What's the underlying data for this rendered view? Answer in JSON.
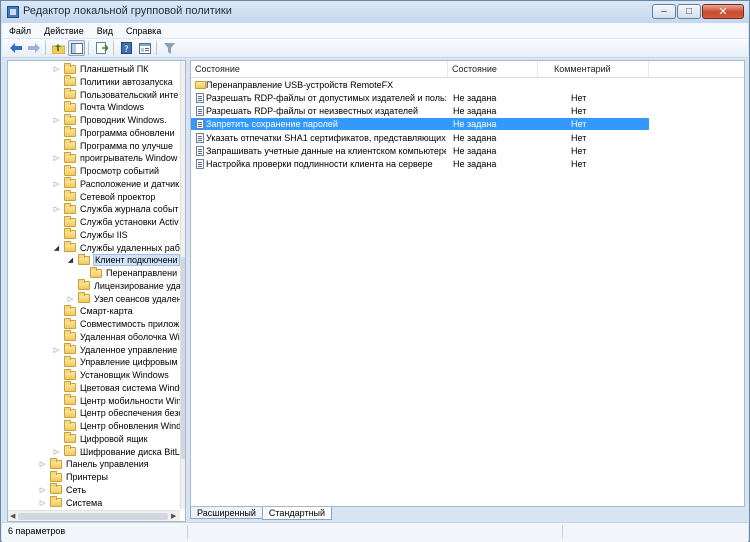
{
  "window": {
    "title": "Редактор локальной групповой политики"
  },
  "menu": [
    "Файл",
    "Действие",
    "Вид",
    "Справка"
  ],
  "toolbar": {
    "icons": [
      "back-arrow",
      "forward-arrow",
      "up-folder",
      "show-hide-tree",
      "export-list",
      "help",
      "properties",
      "filter"
    ],
    "colors": {
      "accent": "#3399ff",
      "nav_arrow": "#2f6fc6"
    }
  },
  "tree": {
    "items": [
      {
        "label": "Планшетный ПК",
        "level": 1,
        "expander": "collapsed"
      },
      {
        "label": "Политики автозапуска",
        "level": 1,
        "expander": ""
      },
      {
        "label": "Пользовательский инте",
        "level": 1,
        "expander": ""
      },
      {
        "label": "Почта Windows",
        "level": 1,
        "expander": ""
      },
      {
        "label": "Проводник Windows.",
        "level": 1,
        "expander": "collapsed"
      },
      {
        "label": "Программа обновлени",
        "level": 1,
        "expander": ""
      },
      {
        "label": "Программа по улучше",
        "level": 1,
        "expander": ""
      },
      {
        "label": "проигрыватель Window",
        "level": 1,
        "expander": "collapsed"
      },
      {
        "label": "Просмотр событий",
        "level": 1,
        "expander": ""
      },
      {
        "label": "Расположение и датчик",
        "level": 1,
        "expander": "collapsed"
      },
      {
        "label": "Сетевой проектор",
        "level": 1,
        "expander": ""
      },
      {
        "label": "Служба журнала событ",
        "level": 1,
        "expander": "collapsed"
      },
      {
        "label": "Служба установки Activ",
        "level": 1,
        "expander": ""
      },
      {
        "label": "Службы IIS",
        "level": 1,
        "expander": ""
      },
      {
        "label": "Службы удаленных раб",
        "level": 1,
        "expander": "expanded"
      },
      {
        "label": "Клиент подключени",
        "level": 2,
        "expander": "expanded",
        "selected": true
      },
      {
        "label": "Перенаправлени",
        "level": 3,
        "expander": ""
      },
      {
        "label": "Лицензирование уда",
        "level": 2,
        "expander": ""
      },
      {
        "label": "Узел сеансов удален",
        "level": 2,
        "expander": "collapsed"
      },
      {
        "label": "Смарт-карта",
        "level": 1,
        "expander": ""
      },
      {
        "label": "Совместимость прилож",
        "level": 1,
        "expander": ""
      },
      {
        "label": "Удаленная оболочка Wi",
        "level": 1,
        "expander": ""
      },
      {
        "label": "Удаленное управление",
        "level": 1,
        "expander": "collapsed"
      },
      {
        "label": "Управление цифровым",
        "level": 1,
        "expander": ""
      },
      {
        "label": "Установщик Windows",
        "level": 1,
        "expander": ""
      },
      {
        "label": "Цветовая система Windo",
        "level": 1,
        "expander": ""
      },
      {
        "label": "Центр мобильности Win",
        "level": 1,
        "expander": ""
      },
      {
        "label": "Центр обеспечения безо",
        "level": 1,
        "expander": ""
      },
      {
        "label": "Центр обновления Wind",
        "level": 1,
        "expander": ""
      },
      {
        "label": "Цифровой ящик",
        "level": 1,
        "expander": ""
      },
      {
        "label": "Шифрование диска BitL",
        "level": 1,
        "expander": "collapsed"
      },
      {
        "label": "Панель управления",
        "level": 0,
        "expander": "collapsed"
      },
      {
        "label": "Принтеры",
        "level": 0,
        "expander": ""
      },
      {
        "label": "Сеть",
        "level": 0,
        "expander": "collapsed"
      },
      {
        "label": "Система",
        "level": 0,
        "expander": "collapsed"
      }
    ]
  },
  "list": {
    "columns": [
      "Состояние",
      "Состояние",
      "Комментарий"
    ],
    "rows": [
      {
        "name": "Перенаправление USB-устройств RemoteFX",
        "state": "",
        "comment": "",
        "icon": "folder-icon"
      },
      {
        "name": "Разрешать RDP-файлы от допустимых издателей и польз...",
        "state": "Не задана",
        "comment": "Нет",
        "icon": "policy-setting-icon"
      },
      {
        "name": "Разрешать RDP-файлы от неизвестных издателей",
        "state": "Не задана",
        "comment": "Нет",
        "icon": "policy-setting-icon"
      },
      {
        "name": "Запретить сохранение паролей",
        "state": "Не задана",
        "comment": "Нет",
        "icon": "policy-setting-icon",
        "selected": true
      },
      {
        "name": "Указать отпечатки SHA1 сертификатов, представляющих ...",
        "state": "Не задана",
        "comment": "Нет",
        "icon": "policy-setting-icon"
      },
      {
        "name": "Запрашивать учетные данные на клиентском компьютере",
        "state": "Не задана",
        "comment": "Нет",
        "icon": "policy-setting-icon"
      },
      {
        "name": "Настройка проверки подлинности клиента на сервере",
        "state": "Не задана",
        "comment": "Нет",
        "icon": "policy-setting-icon"
      }
    ]
  },
  "tabs": [
    "Расширенный",
    "Стандартный"
  ],
  "status": {
    "text": "6 параметров"
  }
}
